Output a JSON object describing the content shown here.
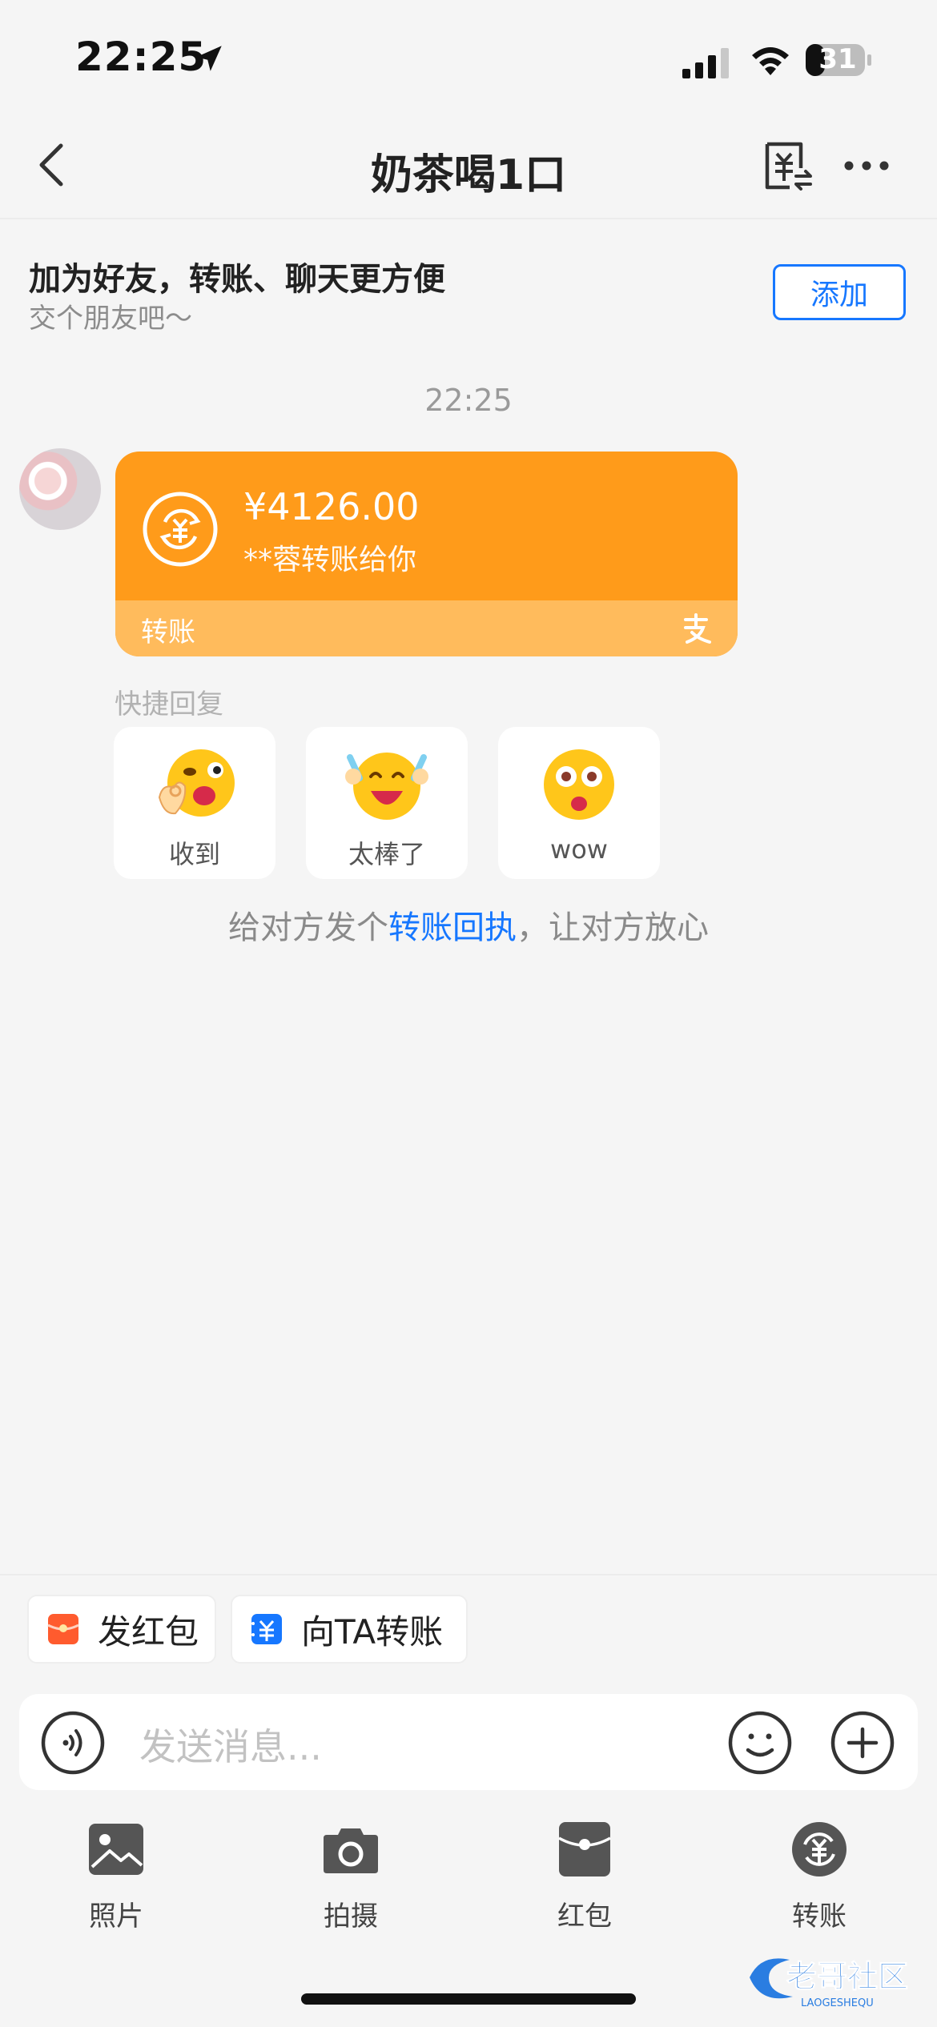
{
  "status_bar": {
    "time": "22:25",
    "battery": "31"
  },
  "nav": {
    "title": "奶茶喝1口"
  },
  "banner": {
    "title": "加为好友，转账、聊天更方便",
    "subtitle": "交个朋友吧～",
    "add_label": "添加"
  },
  "chat": {
    "timestamp": "22:25",
    "transfer": {
      "amount": "¥4126.00",
      "from": "**蓉转账给你",
      "footer_label": "转账"
    },
    "quick_reply_label": "快捷回复",
    "quick_replies": [
      {
        "label": "收到",
        "icon": "ok-hand-emoji-icon"
      },
      {
        "label": "太棒了",
        "icon": "cheering-emoji-icon"
      },
      {
        "label": "wow",
        "icon": "surprised-emoji-icon"
      }
    ],
    "receipt": {
      "prefix": "给对方发个",
      "link": "转账回执",
      "suffix": "，让对方放心"
    }
  },
  "shortcuts": {
    "red_packet": "发红包",
    "transfer_to": "向TA转账"
  },
  "input": {
    "placeholder": "发送消息..."
  },
  "toolbar": [
    {
      "label": "照片",
      "icon": "photo-icon"
    },
    {
      "label": "拍摄",
      "icon": "camera-icon"
    },
    {
      "label": "红包",
      "icon": "red-packet-icon"
    },
    {
      "label": "转账",
      "icon": "transfer-icon"
    }
  ],
  "watermark": {
    "text": "老哥社区",
    "sub": "LAOGESHEQU"
  },
  "colors": {
    "accent": "#1677ff",
    "transfer_card": "#ff9b1a",
    "transfer_footer": "#ffbb5c",
    "red_packet": "#ff5b2e"
  }
}
